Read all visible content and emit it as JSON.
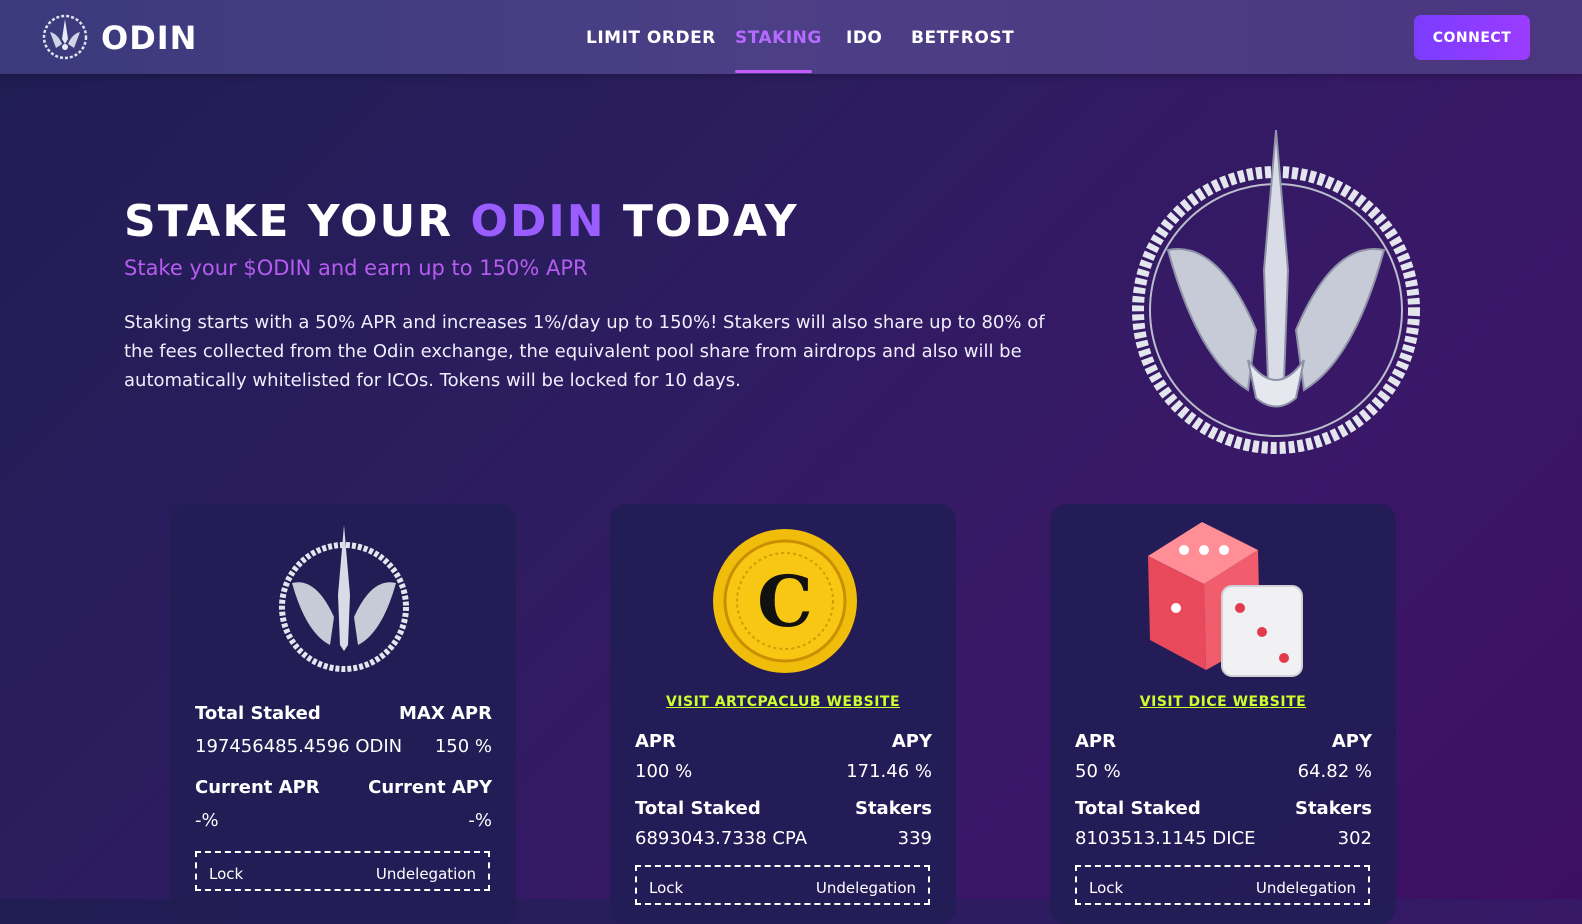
{
  "nav": {
    "brand": "ODIN",
    "items": [
      {
        "label": "LIMIT ORDER"
      },
      {
        "label": "STAKING",
        "active": true
      },
      {
        "label": "IDO"
      },
      {
        "label": "BETFROST"
      }
    ],
    "connect_label": "CONNECT"
  },
  "hero": {
    "title_part1": "STAKE YOUR",
    "title_accent": "ODIN",
    "title_part2": "TODAY",
    "subtitle": "Stake your $ODIN and earn up to 150% APR",
    "body": "Staking starts with a 50% APR and increases 1%/day up to 150%! Stakers will also share up to 80% of the fees collected from the Odin exchange, the equivalent pool share from airdrops and also will be automatically whitelisted for ICOs. Tokens will be locked for 10 days."
  },
  "cards": [
    {
      "icon": "odin-emblem-icon",
      "row1": {
        "left_label": "Total Staked",
        "right_label": "MAX APR"
      },
      "row1_vals": {
        "left": "197456485.4596 ODIN",
        "right": "150 %"
      },
      "row2": {
        "left_label": "Current APR",
        "right_label": "Current APY"
      },
      "row2_vals": {
        "left": "-%",
        "right": "-%"
      },
      "lock": {
        "left": "Lock",
        "right": "Undelegation"
      }
    },
    {
      "icon": "artcpaclub-coin-icon",
      "visit": "VISIT ARTCPACLUB WEBSITE",
      "row1": {
        "left_label": "APR",
        "right_label": "APY"
      },
      "row1_vals": {
        "left": "100 %",
        "right": "171.46 %"
      },
      "row2": {
        "left_label": "Total Staked",
        "right_label": "Stakers"
      },
      "row2_vals": {
        "left": "6893043.7338 CPA",
        "right": "339"
      },
      "lock": {
        "left": "Lock",
        "right": "Undelegation"
      }
    },
    {
      "icon": "dice-icon",
      "visit": "VISIT DICE WEBSITE",
      "row1": {
        "left_label": "APR",
        "right_label": "APY"
      },
      "row1_vals": {
        "left": "50 %",
        "right": "64.82 %"
      },
      "row2": {
        "left_label": "Total Staked",
        "right_label": "Stakers"
      },
      "row2_vals": {
        "left": "8103513.1145 DICE",
        "right": "302"
      },
      "lock": {
        "left": "Lock",
        "right": "Undelegation"
      }
    }
  ],
  "colors": {
    "accent": "#9a5dff",
    "subtitle": "#b75cf0",
    "link": "#ccff2d",
    "button": "#8a3cff"
  }
}
